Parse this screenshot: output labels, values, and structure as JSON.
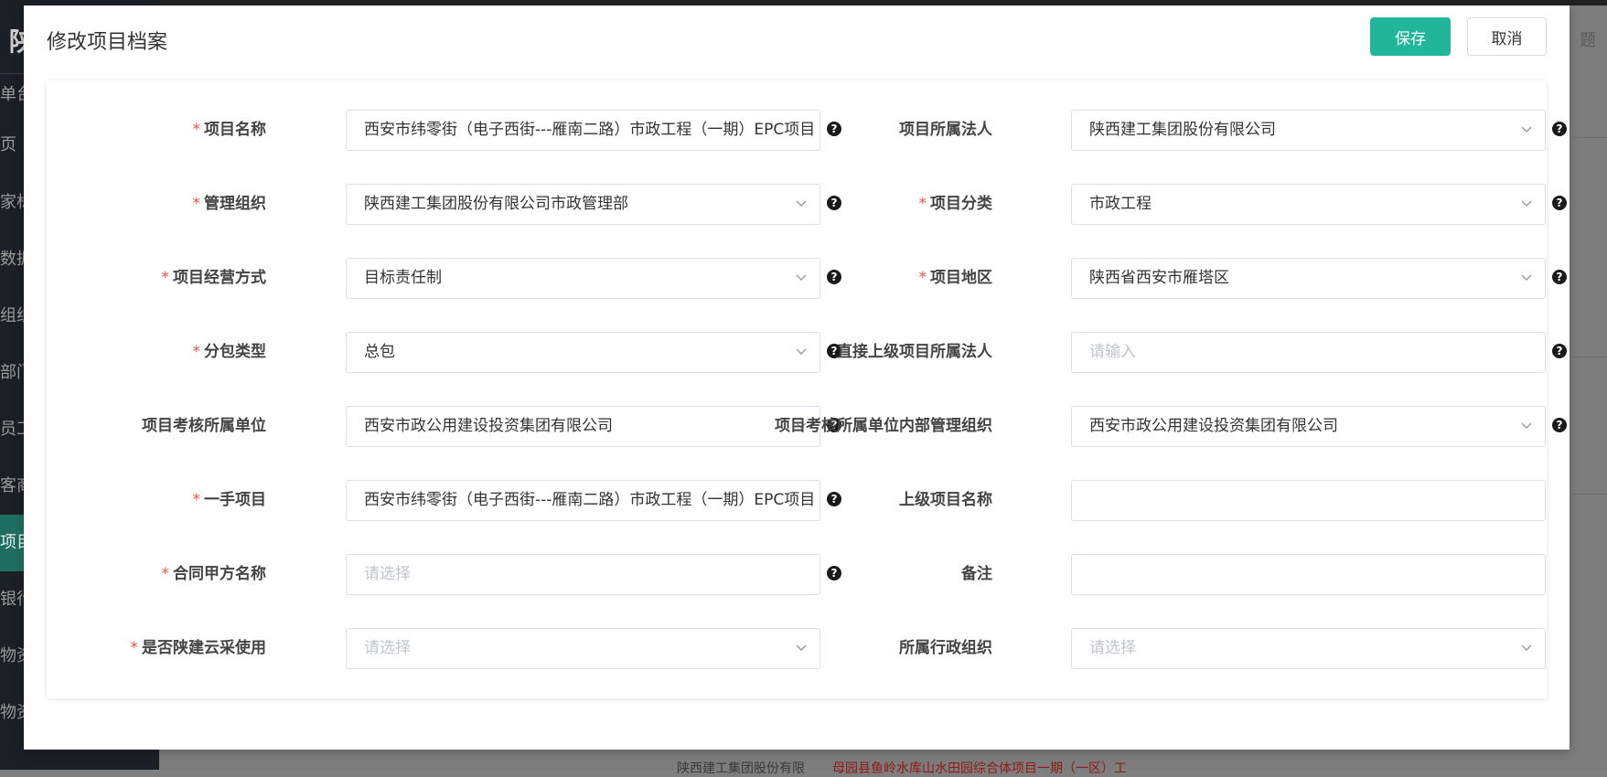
{
  "background": {
    "brand_char": "陕",
    "nav_items": [
      "单台",
      "页",
      "家标",
      "数据",
      "组织",
      "部门",
      "员工",
      "客商",
      "项目",
      "银行",
      "物资",
      "物资"
    ],
    "header_right": "题",
    "table_hint_left": "陕西建工集团股份有限",
    "table_hint_red": "母园县鱼岭水库山水田园综合体项目一期（一区）工"
  },
  "modal": {
    "title": "修改项目档案",
    "save_label": "保存",
    "cancel_label": "取消",
    "help_glyph": "?",
    "fields": {
      "project_name": {
        "label": "项目名称",
        "required": true,
        "value": "西安市纬零街（电子西街---雁南二路）市政工程（一期）EPC项目"
      },
      "legal_entity": {
        "label": "项目所属法人",
        "required": false,
        "value": "陕西建工集团股份有限公司"
      },
      "mgmt_org": {
        "label": "管理组织",
        "required": true,
        "value": "陕西建工集团股份有限公司市政管理部"
      },
      "category": {
        "label": "项目分类",
        "required": true,
        "value": "市政工程"
      },
      "operation_mode": {
        "label": "项目经营方式",
        "required": true,
        "value": "目标责任制"
      },
      "region": {
        "label": "项目地区",
        "required": true,
        "value": "陕西省西安市雁塔区"
      },
      "subcontract_type": {
        "label": "分包类型",
        "required": true,
        "value": "总包"
      },
      "parent_legal_entity": {
        "label": "直接上级项目所属法人",
        "required": false,
        "value": "",
        "placeholder": "请输入"
      },
      "assessment_unit": {
        "label": "项目考核所属单位",
        "required": false,
        "value": "西安市政公用建设投资集团有限公司"
      },
      "assessment_internal_org": {
        "label": "项目考核所属单位内部管理组织",
        "required": false,
        "value": "西安市政公用建设投资集团有限公司"
      },
      "first_hand_project": {
        "label": "一手项目",
        "required": true,
        "value": "西安市纬零街（电子西街---雁南二路）市政工程（一期）EPC项目"
      },
      "parent_project_name": {
        "label": "上级项目名称",
        "required": false,
        "value": ""
      },
      "contract_party_a": {
        "label": "合同甲方名称",
        "required": true,
        "value": "",
        "placeholder": "请选择"
      },
      "remarks": {
        "label": "备注",
        "required": false,
        "value": ""
      },
      "shaanjian_cloud": {
        "label": "是否陕建云采使用",
        "required": true,
        "value": "",
        "placeholder": "请选择"
      },
      "admin_org": {
        "label": "所属行政组织",
        "required": false,
        "value": "",
        "placeholder": "请选择"
      }
    },
    "required_mark": "*"
  },
  "colors": {
    "primary": "#21b69b",
    "required": "#f0504b",
    "border": "#dcdfe6"
  }
}
